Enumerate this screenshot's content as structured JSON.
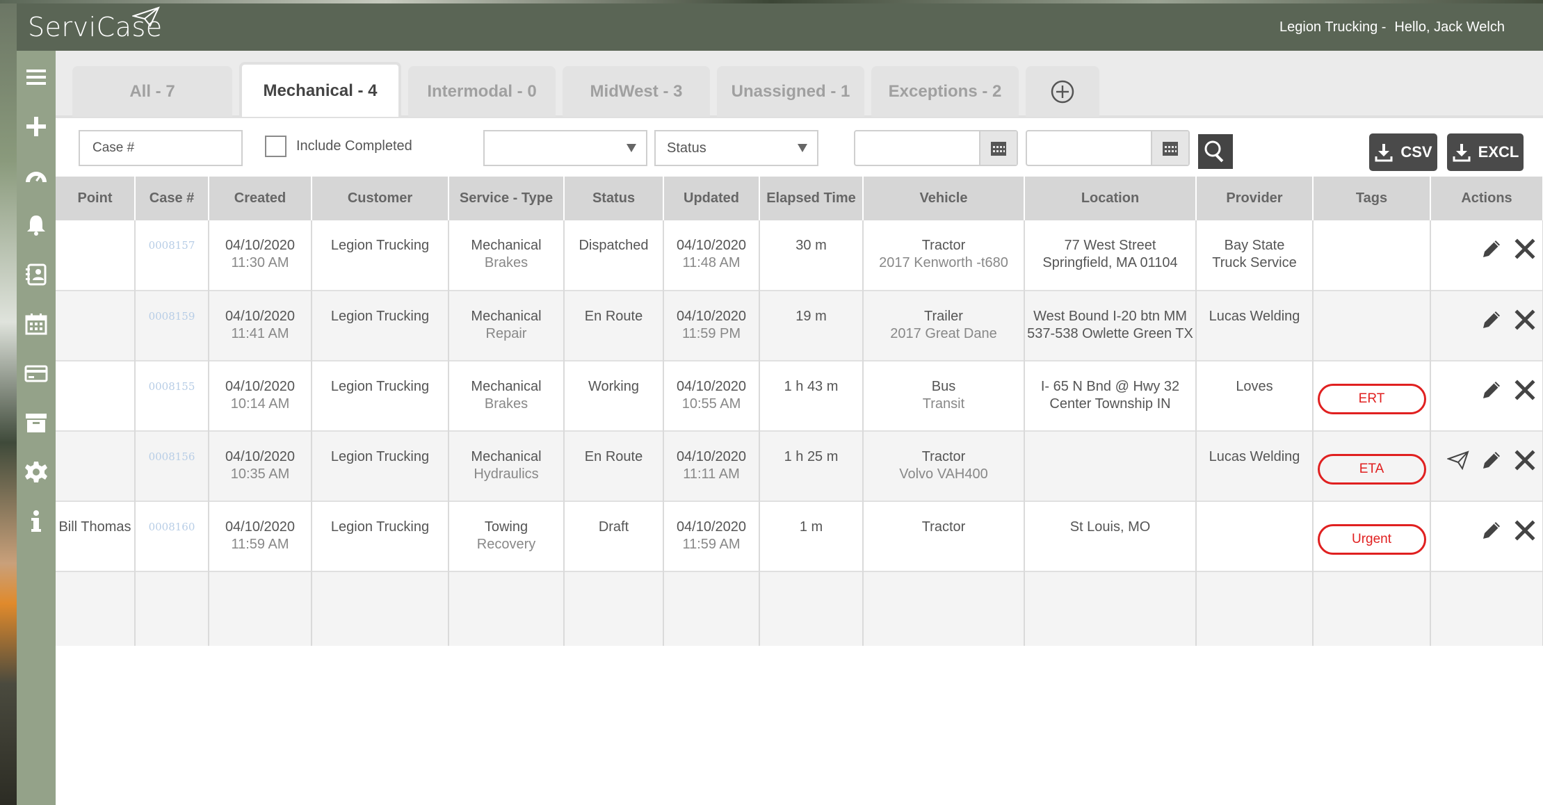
{
  "header": {
    "logo_text": "ServiCase",
    "company": "Legion Trucking -",
    "greeting": "Hello, Jack Welch",
    "bg_color": "#5a6555"
  },
  "sidebar": {
    "bg_color": "#94a289",
    "icons": [
      "menu-icon",
      "plus-icon",
      "dashboard-gauge-icon",
      "bell-icon",
      "contacts-icon",
      "calendar-icon",
      "card-icon",
      "archive-icon",
      "gear-icon",
      "info-icon"
    ]
  },
  "tabs": [
    {
      "label": "All - 7",
      "active": false
    },
    {
      "label": "Mechanical - 4",
      "active": true
    },
    {
      "label": "Intermodal - 0",
      "active": false
    },
    {
      "label": "MidWest - 3",
      "active": false
    },
    {
      "label": "Unassigned - 1",
      "active": false
    },
    {
      "label": "Exceptions - 2",
      "active": false
    }
  ],
  "filters": {
    "case_placeholder": "Case #",
    "include_completed_label": "Include Completed",
    "include_completed_checked": false,
    "select1_value": "",
    "status_value": "Status",
    "date_from": "",
    "date_to": "",
    "csv_label": "CSV",
    "excl_label": "EXCL"
  },
  "table": {
    "columns": [
      "Point",
      "Case #",
      "Created",
      "Customer",
      "Service - Type",
      "Status",
      "Updated",
      "Elapsed Time",
      "Vehicle",
      "Location",
      "Provider",
      "Tags",
      "Actions"
    ],
    "rows": [
      {
        "point": "",
        "case": "0008157",
        "created_date": "04/10/2020",
        "created_time": "11:30 AM",
        "customer": "Legion Trucking",
        "service": "Mechanical",
        "type": "Brakes",
        "status": "Dispatched",
        "updated_date": "04/10/2020",
        "updated_time": "11:48 AM",
        "elapsed": "30 m",
        "vehicle": "Tractor",
        "vehicle_detail": "2017 Kenworth -t680",
        "location1": "77 West Street",
        "location2": "Springfield, MA 01104",
        "provider1": "Bay State",
        "provider2": "Truck Service",
        "tag": "",
        "send": false
      },
      {
        "point": "",
        "case": "0008159",
        "created_date": "04/10/2020",
        "created_time": "11:41 AM",
        "customer": "Legion Trucking",
        "service": "Mechanical",
        "type": "Repair",
        "status": "En Route",
        "updated_date": "04/10/2020",
        "updated_time": "11:59 PM",
        "elapsed": "19 m",
        "vehicle": "Trailer",
        "vehicle_detail": "2017 Great Dane",
        "location1": "West Bound I-20  btn MM",
        "location2": "537-538 Owlette Green TX",
        "provider1": "Lucas Welding",
        "provider2": "",
        "tag": "",
        "send": false
      },
      {
        "point": "",
        "case": "0008155",
        "created_date": "04/10/2020",
        "created_time": "10:14 AM",
        "customer": "Legion Trucking",
        "service": "Mechanical",
        "type": "Brakes",
        "status": "Working",
        "updated_date": "04/10/2020",
        "updated_time": "10:55 AM",
        "elapsed": "1 h 43 m",
        "vehicle": "Bus",
        "vehicle_detail": "Transit",
        "location1": "I- 65 N Bnd @ Hwy 32",
        "location2": "Center Township IN",
        "provider1": "Loves",
        "provider2": "",
        "tag": "ERT",
        "send": false
      },
      {
        "point": "",
        "case": "0008156",
        "created_date": "04/10/2020",
        "created_time": "10:35 AM",
        "customer": "Legion Trucking",
        "service": "Mechanical",
        "type": "Hydraulics",
        "status": "En Route",
        "updated_date": "04/10/2020",
        "updated_time": "11:11 AM",
        "elapsed": "1 h 25 m",
        "vehicle": "Tractor",
        "vehicle_detail": "Volvo VAH400",
        "location1": "",
        "location2": "",
        "provider1": "Lucas Welding",
        "provider2": "",
        "tag": "ETA",
        "send": true
      },
      {
        "point": "Bill Thomas",
        "case": "0008160",
        "created_date": "04/10/2020",
        "created_time": "11:59 AM",
        "customer": "Legion Trucking",
        "service": "Towing",
        "type": "Recovery",
        "status": "Draft",
        "updated_date": "04/10/2020",
        "updated_time": "11:59 AM",
        "elapsed": "1 m",
        "vehicle": "Tractor",
        "vehicle_detail": "",
        "location1": "St Louis, MO",
        "location2": "",
        "provider1": "",
        "provider2": "",
        "tag": "Urgent",
        "send": false
      }
    ]
  },
  "colors": {
    "tag_red": "#e02020",
    "header_gray": "#d6d6d6",
    "button_dark": "#4a4a4a"
  }
}
